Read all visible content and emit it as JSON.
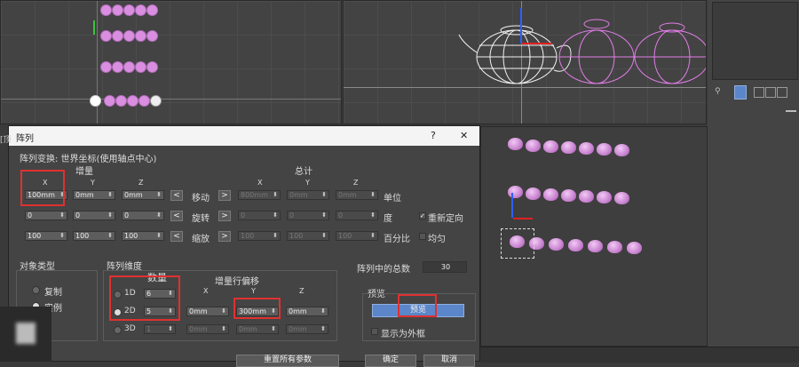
{
  "dialog": {
    "title": "阵列",
    "help_label": "?",
    "close_label": "✕",
    "transform_header": "阵列变换: 世界坐标(使用轴点中心)",
    "increment_label": "增量",
    "total_label": "总计",
    "axis_x": "X",
    "axis_y": "Y",
    "axis_z": "Z",
    "rows": {
      "move": {
        "label": "移动",
        "inc": [
          "100mm",
          "0mm",
          "0mm"
        ],
        "total": [
          "800mm",
          "0mm",
          "0mm"
        ],
        "unit": "单位"
      },
      "rotate": {
        "label": "旋转",
        "inc": [
          "0",
          "0",
          "0"
        ],
        "total": [
          "0",
          "0",
          "0"
        ],
        "unit": "度"
      },
      "scale": {
        "label": "缩放",
        "inc": [
          "100",
          "100",
          "100"
        ],
        "total": [
          "100",
          "100",
          "100"
        ],
        "unit": "百分比"
      }
    },
    "reorient_label": "重新定向",
    "uniform_label": "均匀",
    "object_type": {
      "title": "对象类型",
      "options": [
        "复制",
        "实例"
      ]
    },
    "dimensions": {
      "title": "阵列维度",
      "count_label": "数量",
      "row_offset_label": "增量行偏移",
      "rows": [
        {
          "label": "1D",
          "count": "6"
        },
        {
          "label": "2D",
          "count": "5",
          "offset": [
            "0mm",
            "300mm",
            "0mm"
          ]
        },
        {
          "label": "3D",
          "count": "1",
          "offset": [
            "0mm",
            "0mm",
            "0mm"
          ]
        }
      ]
    },
    "total_in_array_label": "阵列中的总数",
    "total_in_array_value": "30",
    "preview": {
      "title": "预览",
      "button_label": "预览",
      "box_label": "显示为外框"
    },
    "reset_button": "重置所有参数",
    "ok_button": "确定",
    "cancel_button": "取消"
  },
  "viewport_top_left": {
    "label": "[顶"
  },
  "colors": {
    "accent": "#e03030",
    "bead": "#d98ee0",
    "preview_button": "#5b86c9"
  }
}
